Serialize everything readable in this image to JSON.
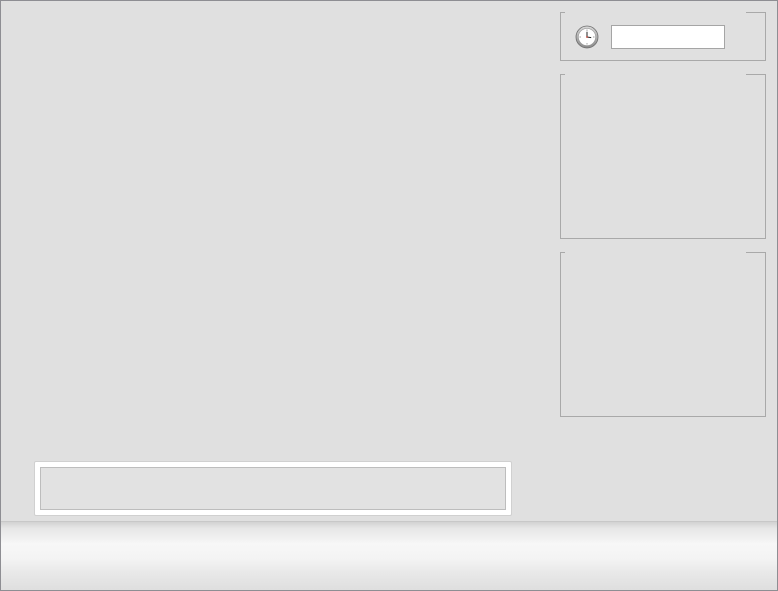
{
  "window": {
    "background_color": "#e0e0e0",
    "border_color": "#8e8e93"
  },
  "clock_panel": {
    "legend": "",
    "icon": "clock-icon",
    "time_value": "",
    "time_placeholder": ""
  },
  "panel_top": {
    "legend": ""
  },
  "panel_bottom": {
    "legend": ""
  },
  "message": {
    "text": ""
  }
}
